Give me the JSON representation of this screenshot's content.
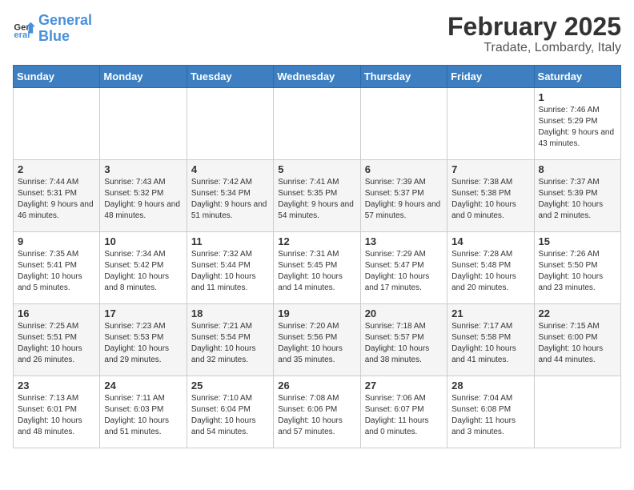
{
  "header": {
    "logo_line1": "General",
    "logo_line2": "Blue",
    "month_title": "February 2025",
    "location": "Tradate, Lombardy, Italy"
  },
  "days_of_week": [
    "Sunday",
    "Monday",
    "Tuesday",
    "Wednesday",
    "Thursday",
    "Friday",
    "Saturday"
  ],
  "weeks": [
    [
      {
        "num": "",
        "info": ""
      },
      {
        "num": "",
        "info": ""
      },
      {
        "num": "",
        "info": ""
      },
      {
        "num": "",
        "info": ""
      },
      {
        "num": "",
        "info": ""
      },
      {
        "num": "",
        "info": ""
      },
      {
        "num": "1",
        "info": "Sunrise: 7:46 AM\nSunset: 5:29 PM\nDaylight: 9 hours and 43 minutes."
      }
    ],
    [
      {
        "num": "2",
        "info": "Sunrise: 7:44 AM\nSunset: 5:31 PM\nDaylight: 9 hours and 46 minutes."
      },
      {
        "num": "3",
        "info": "Sunrise: 7:43 AM\nSunset: 5:32 PM\nDaylight: 9 hours and 48 minutes."
      },
      {
        "num": "4",
        "info": "Sunrise: 7:42 AM\nSunset: 5:34 PM\nDaylight: 9 hours and 51 minutes."
      },
      {
        "num": "5",
        "info": "Sunrise: 7:41 AM\nSunset: 5:35 PM\nDaylight: 9 hours and 54 minutes."
      },
      {
        "num": "6",
        "info": "Sunrise: 7:39 AM\nSunset: 5:37 PM\nDaylight: 9 hours and 57 minutes."
      },
      {
        "num": "7",
        "info": "Sunrise: 7:38 AM\nSunset: 5:38 PM\nDaylight: 10 hours and 0 minutes."
      },
      {
        "num": "8",
        "info": "Sunrise: 7:37 AM\nSunset: 5:39 PM\nDaylight: 10 hours and 2 minutes."
      }
    ],
    [
      {
        "num": "9",
        "info": "Sunrise: 7:35 AM\nSunset: 5:41 PM\nDaylight: 10 hours and 5 minutes."
      },
      {
        "num": "10",
        "info": "Sunrise: 7:34 AM\nSunset: 5:42 PM\nDaylight: 10 hours and 8 minutes."
      },
      {
        "num": "11",
        "info": "Sunrise: 7:32 AM\nSunset: 5:44 PM\nDaylight: 10 hours and 11 minutes."
      },
      {
        "num": "12",
        "info": "Sunrise: 7:31 AM\nSunset: 5:45 PM\nDaylight: 10 hours and 14 minutes."
      },
      {
        "num": "13",
        "info": "Sunrise: 7:29 AM\nSunset: 5:47 PM\nDaylight: 10 hours and 17 minutes."
      },
      {
        "num": "14",
        "info": "Sunrise: 7:28 AM\nSunset: 5:48 PM\nDaylight: 10 hours and 20 minutes."
      },
      {
        "num": "15",
        "info": "Sunrise: 7:26 AM\nSunset: 5:50 PM\nDaylight: 10 hours and 23 minutes."
      }
    ],
    [
      {
        "num": "16",
        "info": "Sunrise: 7:25 AM\nSunset: 5:51 PM\nDaylight: 10 hours and 26 minutes."
      },
      {
        "num": "17",
        "info": "Sunrise: 7:23 AM\nSunset: 5:53 PM\nDaylight: 10 hours and 29 minutes."
      },
      {
        "num": "18",
        "info": "Sunrise: 7:21 AM\nSunset: 5:54 PM\nDaylight: 10 hours and 32 minutes."
      },
      {
        "num": "19",
        "info": "Sunrise: 7:20 AM\nSunset: 5:56 PM\nDaylight: 10 hours and 35 minutes."
      },
      {
        "num": "20",
        "info": "Sunrise: 7:18 AM\nSunset: 5:57 PM\nDaylight: 10 hours and 38 minutes."
      },
      {
        "num": "21",
        "info": "Sunrise: 7:17 AM\nSunset: 5:58 PM\nDaylight: 10 hours and 41 minutes."
      },
      {
        "num": "22",
        "info": "Sunrise: 7:15 AM\nSunset: 6:00 PM\nDaylight: 10 hours and 44 minutes."
      }
    ],
    [
      {
        "num": "23",
        "info": "Sunrise: 7:13 AM\nSunset: 6:01 PM\nDaylight: 10 hours and 48 minutes."
      },
      {
        "num": "24",
        "info": "Sunrise: 7:11 AM\nSunset: 6:03 PM\nDaylight: 10 hours and 51 minutes."
      },
      {
        "num": "25",
        "info": "Sunrise: 7:10 AM\nSunset: 6:04 PM\nDaylight: 10 hours and 54 minutes."
      },
      {
        "num": "26",
        "info": "Sunrise: 7:08 AM\nSunset: 6:06 PM\nDaylight: 10 hours and 57 minutes."
      },
      {
        "num": "27",
        "info": "Sunrise: 7:06 AM\nSunset: 6:07 PM\nDaylight: 11 hours and 0 minutes."
      },
      {
        "num": "28",
        "info": "Sunrise: 7:04 AM\nSunset: 6:08 PM\nDaylight: 11 hours and 3 minutes."
      },
      {
        "num": "",
        "info": ""
      }
    ]
  ]
}
